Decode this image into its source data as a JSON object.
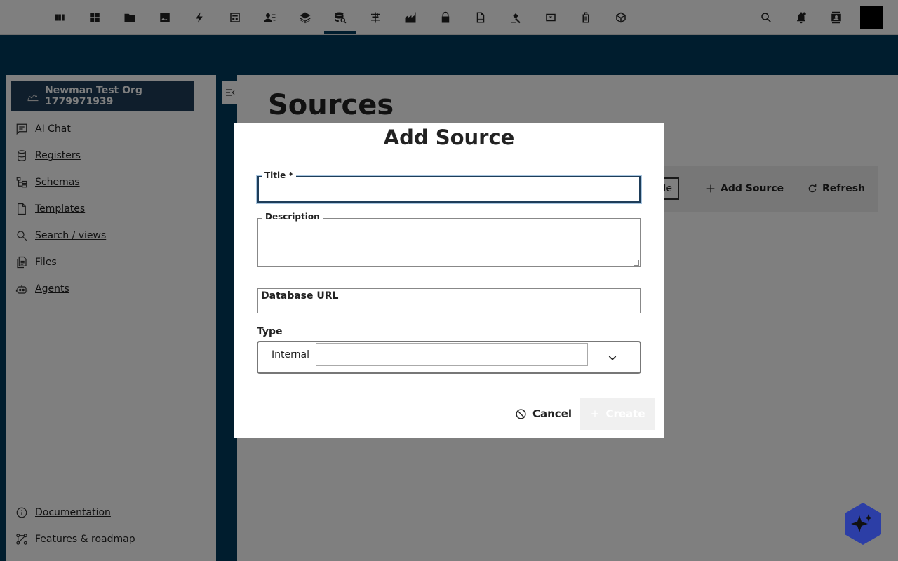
{
  "topbar": {
    "icons": [
      "columns-icon",
      "dashboard-icon",
      "folder-icon",
      "image-icon",
      "bolt-icon",
      "layout-icon",
      "user-list-icon",
      "layers-icon",
      "database-search-icon",
      "schema-icon",
      "factory-icon",
      "lock-icon",
      "document-icon",
      "gavel-icon",
      "update-icon",
      "luggage-icon",
      "cube-icon"
    ],
    "right_icons": [
      "search-icon",
      "notification-icon",
      "contacts-icon"
    ],
    "active_index": 8
  },
  "sidebar": {
    "org_name": "Newman Test Org 1779971939",
    "items": [
      {
        "label": "AI Chat",
        "icon": "chat-icon"
      },
      {
        "label": "Registers",
        "icon": "database-icon"
      },
      {
        "label": "Schemas",
        "icon": "schema-tree-icon"
      },
      {
        "label": "Templates",
        "icon": "file-icon"
      },
      {
        "label": "Search / views",
        "icon": "search-icon"
      },
      {
        "label": "Files",
        "icon": "files-icon"
      },
      {
        "label": "Agents",
        "icon": "robot-icon"
      }
    ],
    "bottom_items": [
      {
        "label": "Documentation",
        "icon": "info-icon"
      },
      {
        "label": "Features & roadmap",
        "icon": "roadmap-icon"
      }
    ]
  },
  "main": {
    "title": "Sources",
    "toolbar": {
      "partial_label": "le",
      "add_source_label": "Add Source",
      "refresh_label": "Refresh"
    }
  },
  "modal": {
    "title": "Add Source",
    "fields": {
      "title_label": "Title *",
      "title_value": "",
      "description_label": "Description",
      "description_value": "",
      "database_url_label": "Database URL",
      "database_url_value": ""
    },
    "type": {
      "label": "Type",
      "selected": "Internal"
    },
    "cancel_label": "Cancel",
    "create_label": "Create"
  },
  "colors": {
    "brand": "#003a5d",
    "org_button": "#1e3d59",
    "fab": "#2c3ea6"
  }
}
